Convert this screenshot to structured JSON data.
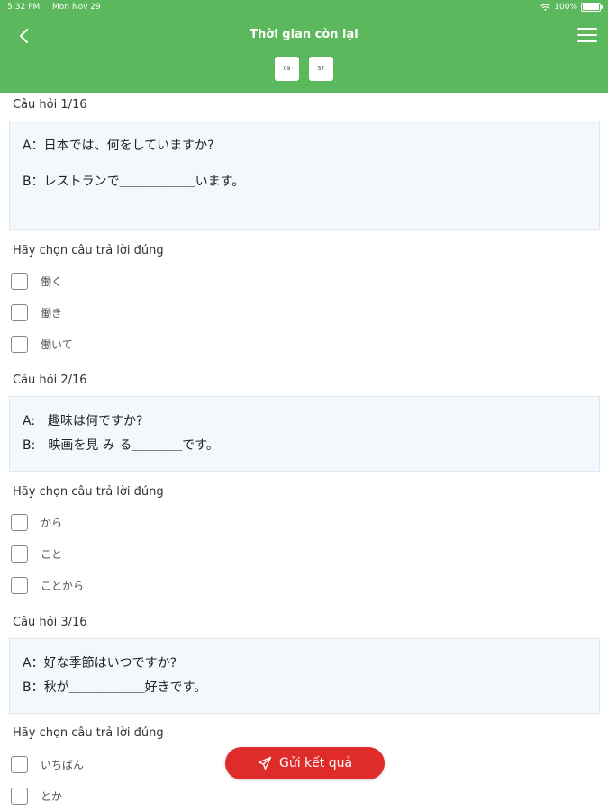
{
  "status_bar": {
    "time": "5:32 PM",
    "date": "Mon Nov 29",
    "battery": "100%"
  },
  "header": {
    "title": "Thời gian còn lại",
    "timer_minutes": "09",
    "timer_seconds": "57",
    "separator": ":"
  },
  "prompt": "Hãy chọn câu trả lời đúng",
  "questions": [
    {
      "label": "Câu hỏi 1/16",
      "lines": [
        "A：日本では、何をしていますか?",
        "B：レストランで＿＿＿＿＿＿います。"
      ],
      "options": [
        "働く",
        "働き",
        "働いて"
      ]
    },
    {
      "label": "Câu hỏi 2/16",
      "lines": [
        "A:　趣味は何ですか?",
        "B:　映画を見 み る＿＿＿＿です。"
      ],
      "options": [
        "から",
        "こと",
        "ことから"
      ]
    },
    {
      "label": "Câu hỏi 3/16",
      "lines": [
        "A：好な季節はいつですか?",
        "B：秋が＿＿＿＿＿＿好きです。"
      ],
      "options": [
        "いちばん",
        "とか"
      ]
    }
  ],
  "submit_label": "Gửi kết quả",
  "colors": {
    "header": "#5cb85c",
    "submit": "#e02b2b",
    "question_box": "#f3f8fd"
  }
}
